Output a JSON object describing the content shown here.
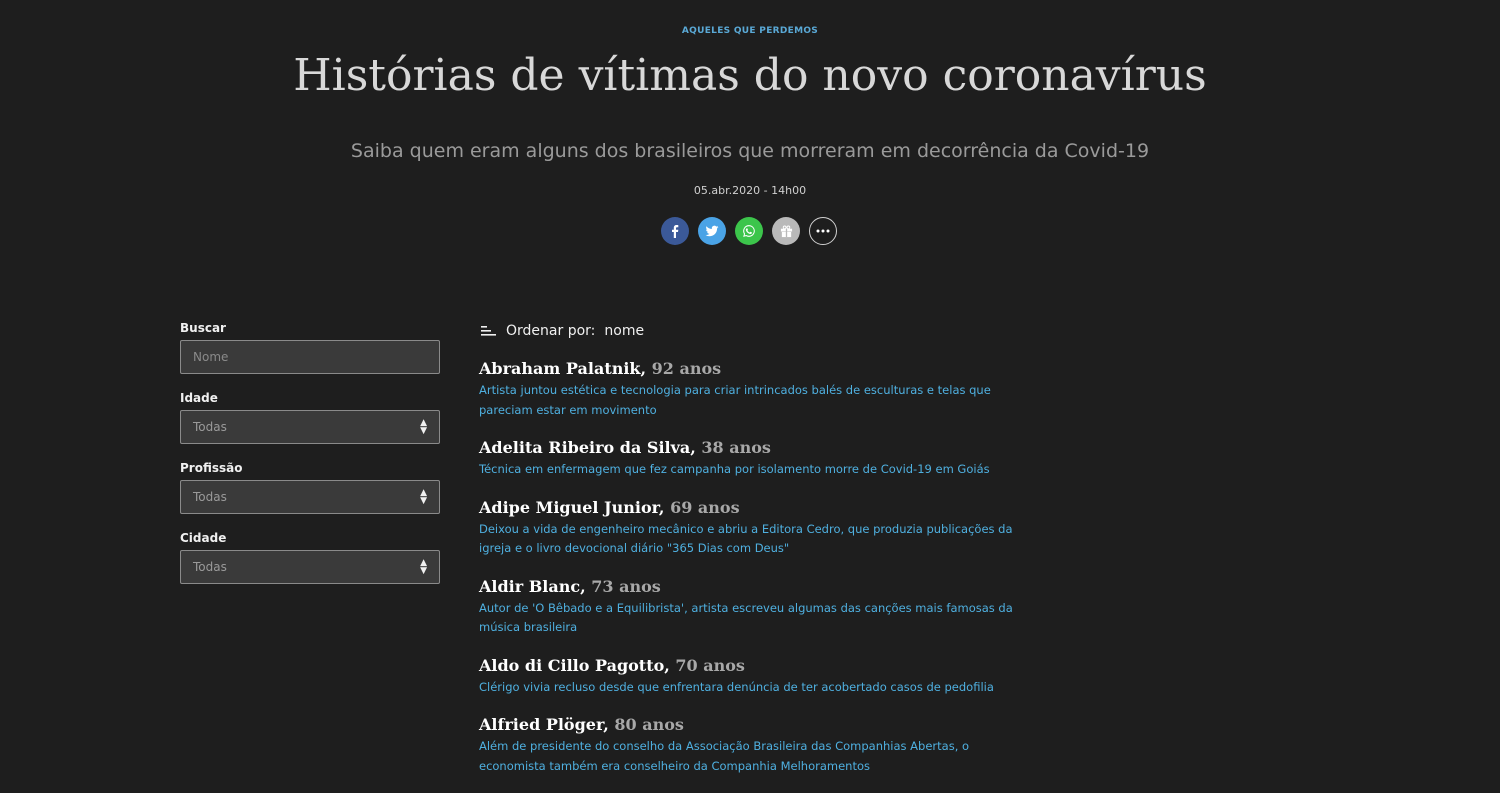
{
  "header": {
    "kicker": "AQUELES QUE PERDEMOS",
    "title": "Histórias de vítimas do novo coronavírus",
    "subtitle": "Saiba quem eram alguns dos brasileiros que morreram em decorrência da Covid-19",
    "date": "05.abr.2020 - 14h00"
  },
  "share": {
    "icons": [
      "facebook-icon",
      "twitter-icon",
      "whatsapp-icon",
      "gift-icon",
      "more-icon"
    ],
    "colors": {
      "facebook": "#3b5998",
      "twitter": "#4aa3e6",
      "whatsapp": "#3cc54b",
      "gift": "#b9b9b9"
    }
  },
  "filters": {
    "search_label": "Buscar",
    "search_placeholder": "Nome",
    "age_label": "Idade",
    "age_value": "Todas",
    "profession_label": "Profissão",
    "profession_value": "Todas",
    "city_label": "Cidade",
    "city_value": "Todas"
  },
  "sort": {
    "label": "Ordenar por:",
    "value": "nome"
  },
  "entries": [
    {
      "name": "Abraham Palatnik,",
      "age": "92 anos",
      "desc": "Artista juntou estética e tecnologia para criar intrincados balés de esculturas e telas que pareciam estar em movimento"
    },
    {
      "name": "Adelita Ribeiro da Silva,",
      "age": "38 anos",
      "desc": "Técnica em enfermagem que fez campanha por isolamento morre de Covid-19 em Goiás"
    },
    {
      "name": "Adipe Miguel Junior,",
      "age": "69 anos",
      "desc": "Deixou a vida de engenheiro mecânico e abriu a Editora Cedro, que produzia publicações da igreja e o livro devocional diário \"365 Dias com Deus\""
    },
    {
      "name": "Aldir Blanc,",
      "age": "73 anos",
      "desc": "Autor de 'O Bêbado e a Equilibrista', artista escreveu algumas das canções mais famosas da música brasileira"
    },
    {
      "name": "Aldo di Cillo Pagotto,",
      "age": "70 anos",
      "desc": "Clérigo vivia recluso desde que enfrentara denúncia de ter acobertado casos de pedofilia"
    },
    {
      "name": "Alfried Plöger,",
      "age": "80 anos",
      "desc": "Além de presidente do conselho da Associação Brasileira das Companhias Abertas, o economista também era conselheiro da Companhia Melhoramentos"
    }
  ]
}
